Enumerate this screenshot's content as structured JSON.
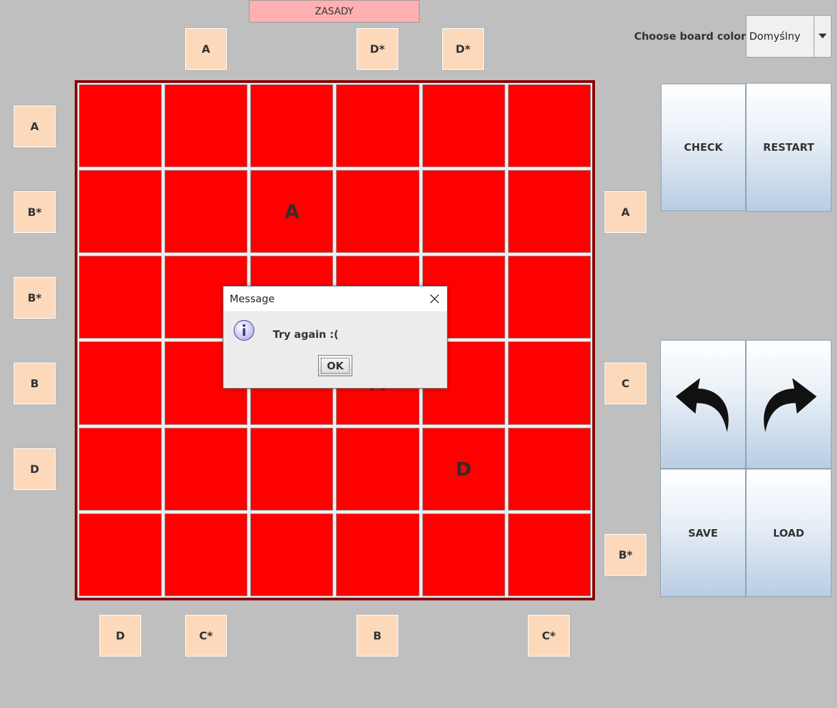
{
  "rules_button": "ZASADY",
  "clues": {
    "top": [
      "A",
      "D*",
      "D*"
    ],
    "left": [
      "A",
      "B*",
      "B*",
      "B",
      "D"
    ],
    "right": [
      "A",
      "C",
      "B*"
    ],
    "bottom": [
      "D",
      "C*",
      "B",
      "C*"
    ]
  },
  "board": {
    "rows": [
      [
        "",
        "",
        "",
        "",
        "",
        ""
      ],
      [
        "",
        "",
        "A",
        "",
        "",
        ""
      ],
      [
        "",
        "",
        "",
        "",
        "",
        ""
      ],
      [
        "",
        "",
        "",
        "A",
        "",
        ""
      ],
      [
        "",
        "",
        "",
        "",
        "D",
        ""
      ],
      [
        "",
        "",
        "",
        "",
        "",
        ""
      ]
    ]
  },
  "colors": {
    "board_cell": "#ff0000",
    "board_border": "#8b0000",
    "clue_bg": "#fdd9bb",
    "rules_bg": "#ffb0b0"
  },
  "color_picker": {
    "label": "Choose board color:",
    "value": "Domyślny"
  },
  "controls": {
    "check": "CHECK",
    "restart": "RESTART",
    "undo_icon": "undo-arrow-icon",
    "redo_icon": "redo-arrow-icon",
    "save": "SAVE",
    "load": "LOAD"
  },
  "dialog": {
    "title": "Message",
    "message": "Try again :(",
    "ok": "OK",
    "icon": "info-icon"
  }
}
